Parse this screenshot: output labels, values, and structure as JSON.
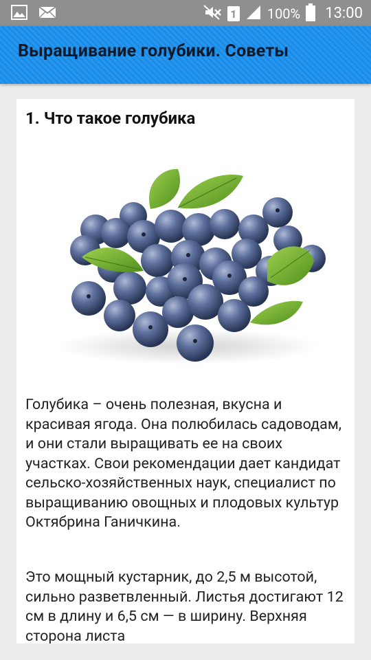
{
  "status_bar": {
    "battery": "100%",
    "time": "13:00",
    "sim": "1",
    "icons": [
      "gallery-icon",
      "mail-icon",
      "mute-icon",
      "signal-icon",
      "battery-icon"
    ]
  },
  "app_bar": {
    "title": "Выращивание голубики. Советы",
    "color": "#2196f3"
  },
  "article": {
    "section_title": "1. Что такое голубика",
    "image": "blueberries-photo",
    "paragraphs": [
      "Голубика – очень полезная, вкусна и красивая ягода. Она полюбилась садоводам, и они стали выращивать ее на своих участках. Свои рекомендации дает кандидат сельско-хозяйственных наук, специалист по выращиванию овощных и плодовых культур Октябрина Ганичкина.",
      "Это мощный кустарник, до 2,5 м высотой, сильно разветвленный. Листья достигают 12 см в длину и 6,5 см — в ширину. Верхняя сторона листа"
    ]
  }
}
